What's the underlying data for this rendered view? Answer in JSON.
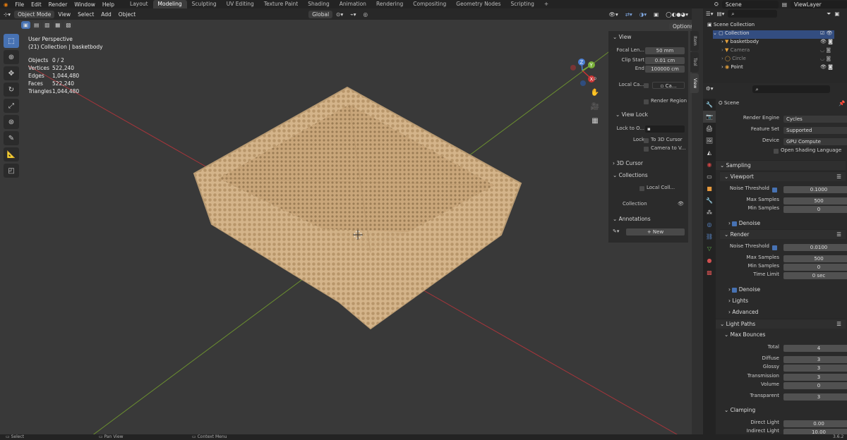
{
  "menubar": {
    "items": [
      "File",
      "Edit",
      "Render",
      "Window",
      "Help"
    ]
  },
  "workspaces": [
    "Layout",
    "Modeling",
    "Sculpting",
    "UV Editing",
    "Texture Paint",
    "Shading",
    "Animation",
    "Rendering",
    "Compositing",
    "Geometry Nodes",
    "Scripting"
  ],
  "active_workspace": "Modeling",
  "scene_field": "Scene",
  "viewlayer_field": "ViewLayer",
  "header": {
    "mode": "Object Mode",
    "menus": [
      "View",
      "Select",
      "Add",
      "Object"
    ],
    "orientation": "Global",
    "options": "Options"
  },
  "overlay": {
    "view_name": "User Perspective",
    "collection": "(21) Collection | basketbody",
    "stats": [
      {
        "label": "Objects",
        "value": "0 / 2"
      },
      {
        "label": "Vertices",
        "value": "522,240"
      },
      {
        "label": "Edges",
        "value": "1,044,480"
      },
      {
        "label": "Faces",
        "value": "522,240"
      },
      {
        "label": "Triangles",
        "value": "1,044,480"
      }
    ]
  },
  "npanel": {
    "view_title": "View",
    "focal_label": "Focal Len...",
    "focal_value": "50 mm",
    "clip_start_label": "Clip Start",
    "clip_start_value": "0.01 cm",
    "end_label": "End",
    "end_value": "100000 cm",
    "local_camera_label": "Local Ca...",
    "local_camera_value": "Ca...",
    "render_region": "Render Region",
    "view_lock": "View Lock",
    "lock_to_label": "Lock to O...",
    "lock_label": "Lock",
    "to_3d_cursor": "To 3D Cursor",
    "camera_to_view": "Camera to V...",
    "cursor_3d": "3D Cursor",
    "collections": "Collections",
    "local_coll": "Local Coll...",
    "collection": "Collection",
    "annotations": "Annotations",
    "new_label": "New",
    "tabs": [
      "Item",
      "Tool",
      "View"
    ]
  },
  "outliner": {
    "root": "Scene Collection",
    "collection": "Collection",
    "items": [
      "basketbody",
      "Camera",
      "Circle",
      "Point"
    ]
  },
  "properties": {
    "scene_label": "Scene",
    "render_engine_label": "Render Engine",
    "render_engine": "Cycles",
    "feature_set_label": "Feature Set",
    "feature_set": "Supported",
    "device_label": "Device",
    "device": "GPU Compute",
    "osl": "Open Shading Language",
    "sampling": "Sampling",
    "viewport": "Viewport",
    "vp_noise_label": "Noise Threshold",
    "vp_noise": "0.1000",
    "vp_max_label": "Max Samples",
    "vp_max": "500",
    "vp_min_label": "Min Samples",
    "vp_min": "0",
    "denoise": "Denoise",
    "render": "Render",
    "r_noise_label": "Noise Threshold",
    "r_noise": "0.0100",
    "r_max_label": "Max Samples",
    "r_max": "500",
    "r_min_label": "Min Samples",
    "r_min": "0",
    "time_limit_label": "Time Limit",
    "time_limit": "0 sec",
    "denoise2": "Denoise",
    "lights": "Lights",
    "advanced": "Advanced",
    "light_paths": "Light Paths",
    "max_bounces": "Max Bounces",
    "total_label": "Total",
    "total": "4",
    "diffuse_label": "Diffuse",
    "diffuse": "3",
    "glossy_label": "Glossy",
    "glossy": "3",
    "transmission_label": "Transmission",
    "transmission": "3",
    "volume_label": "Volume",
    "volume": "0",
    "transparent_label": "Transparent",
    "transparent": "3",
    "clamping": "Clamping",
    "direct_label": "Direct Light",
    "direct": "0.00",
    "indirect_label": "Indirect Light",
    "indirect": "10.00"
  },
  "statusbar": {
    "select": "Select",
    "pan": "Pan View",
    "context": "Context Menu",
    "version": "3.6.2"
  },
  "colors": {
    "accent": "#4772b3",
    "object": "#c9a67a",
    "x_axis": "#c0392b",
    "y_axis": "#7ab03a"
  }
}
